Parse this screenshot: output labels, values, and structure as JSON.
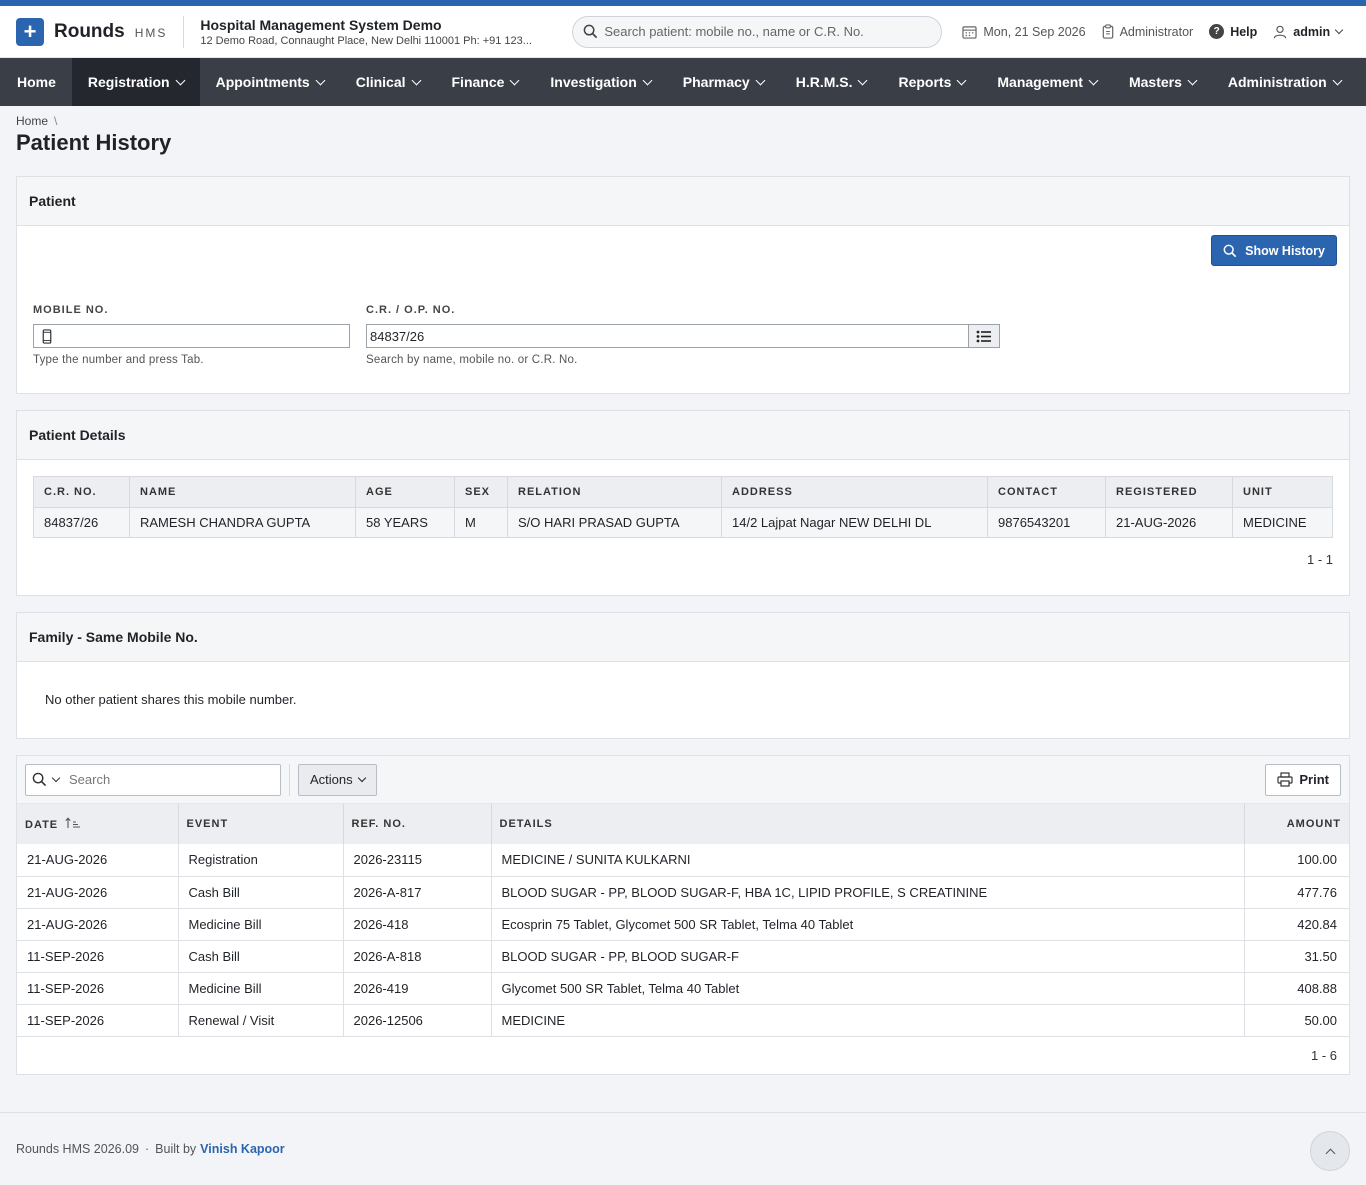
{
  "header": {
    "brand": "Rounds",
    "brand_sub": "HMS",
    "hospital_name": "Hospital Management System Demo",
    "hospital_address": "12 Demo Road, Connaught Place, New Delhi 110001 Ph: +91 123...",
    "search_placeholder": "Search patient: mobile no., name or C.R. No.",
    "date": "Mon, 21 Sep 2026",
    "role": "Administrator",
    "help": "Help",
    "user": "admin"
  },
  "nav": {
    "items": [
      "Home",
      "Registration",
      "Appointments",
      "Clinical",
      "Finance",
      "Investigation",
      "Pharmacy",
      "H.R.M.S.",
      "Reports",
      "Management",
      "Masters",
      "Administration"
    ],
    "active": "Registration"
  },
  "breadcrumb": {
    "home": "Home"
  },
  "page_title": "Patient History",
  "patient_panel": {
    "title": "Patient",
    "show_history": "Show History",
    "mobile_label": "MOBILE NO.",
    "mobile_value": "",
    "mobile_help": "Type the number and press Tab.",
    "cr_label": "C.R. / O.P. NO.",
    "cr_value": "84837/26",
    "cr_help": "Search by name, mobile no. or C.R. No."
  },
  "details_panel": {
    "title": "Patient Details",
    "columns": [
      "C.R. NO.",
      "NAME",
      "AGE",
      "SEX",
      "RELATION",
      "ADDRESS",
      "CONTACT",
      "REGISTERED",
      "UNIT"
    ],
    "row": [
      "84837/26",
      "RAMESH CHANDRA GUPTA",
      "58 YEARS",
      "M",
      "S/O HARI PRASAD GUPTA",
      "14/2 Lajpat Nagar NEW DELHI DL",
      "9876543201",
      "21-AUG-2026",
      "MEDICINE"
    ],
    "pager": "1 - 1"
  },
  "family_panel": {
    "title": "Family - Same Mobile No.",
    "message": "No other patient shares this mobile number."
  },
  "history": {
    "search_placeholder": "Search",
    "actions": "Actions",
    "print": "Print",
    "columns": [
      "DATE",
      "EVENT",
      "REF. NO.",
      "DETAILS",
      "AMOUNT"
    ],
    "rows": [
      [
        "21-AUG-2026",
        "Registration",
        "2026-23115",
        "MEDICINE / SUNITA KULKARNI",
        "100.00"
      ],
      [
        "21-AUG-2026",
        "Cash Bill",
        "2026-A-817",
        "BLOOD SUGAR - PP, BLOOD SUGAR-F, HBA 1C, LIPID PROFILE, S CREATININE",
        "477.76"
      ],
      [
        "21-AUG-2026",
        "Medicine Bill",
        "2026-418",
        "Ecosprin 75 Tablet, Glycomet 500 SR Tablet, Telma 40 Tablet",
        "420.84"
      ],
      [
        "11-SEP-2026",
        "Cash Bill",
        "2026-A-818",
        "BLOOD SUGAR - PP, BLOOD SUGAR-F",
        "31.50"
      ],
      [
        "11-SEP-2026",
        "Medicine Bill",
        "2026-419",
        "Glycomet 500 SR Tablet, Telma 40 Tablet",
        "408.88"
      ],
      [
        "11-SEP-2026",
        "Renewal / Visit",
        "2026-12506",
        "MEDICINE",
        "50.00"
      ]
    ],
    "pager": "1 - 6"
  },
  "footer": {
    "version": "Rounds HMS 2026.09",
    "built_by": "Built by",
    "author": "Vinish Kapoor"
  },
  "colors": {
    "accent": "#2b65b0",
    "nav_bg": "#3a3f47",
    "nav_active": "#24282e"
  }
}
